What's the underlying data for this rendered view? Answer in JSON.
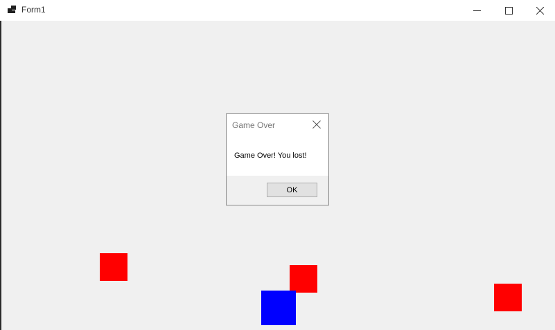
{
  "window": {
    "title": "Form1",
    "icon": "form-app-icon",
    "controls": {
      "minimize_icon": "minimize-icon",
      "maximize_icon": "maximize-icon",
      "close_icon": "close-icon"
    }
  },
  "game": {
    "enemy_color": "#ff0000",
    "player_color": "#0000ff",
    "enemy_count": 3
  },
  "dialog": {
    "title": "Game Over",
    "message": "Game Over! You lost!",
    "ok_label": "OK",
    "close_icon": "close-icon"
  }
}
